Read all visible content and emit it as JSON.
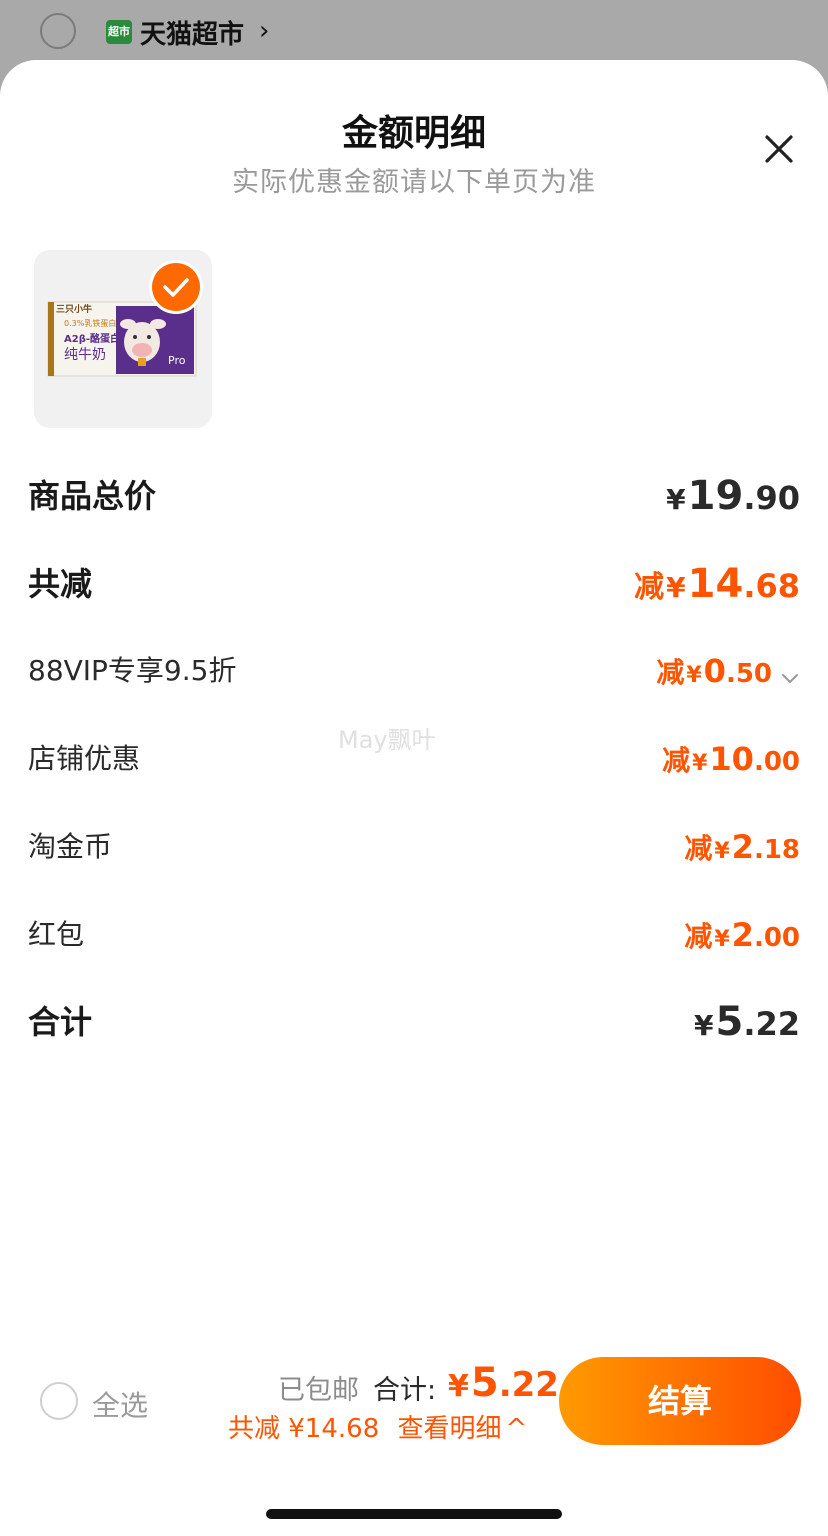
{
  "background_header": {
    "store_logo_text": "超市",
    "store_name": "天猫超市",
    "chevron": "›"
  },
  "sheet": {
    "title": "金额明细",
    "subtitle": "实际优惠金额请以下单页为准",
    "close_icon": "close-icon"
  },
  "product": {
    "thumbnail_icon": "milk-box-image",
    "selected": true,
    "image_texts": {
      "brand": "三只小牛",
      "tag": "0.3%乳铁蛋白",
      "line1": "A2β-酪蛋白",
      "line2": "纯牛奶",
      "pro": "Pro"
    }
  },
  "rows": [
    {
      "label": "商品总价",
      "prefix": "",
      "yen": "¥",
      "int": "19",
      "dec": ".90",
      "style": "major",
      "color": "black"
    },
    {
      "label": "共减",
      "prefix": "减",
      "yen": "¥",
      "int": "14",
      "dec": ".68",
      "style": "major",
      "color": "orange"
    },
    {
      "label": "88VIP专享9.5折",
      "prefix": "减",
      "yen": "¥",
      "int": "0",
      "dec": ".50",
      "style": "minor",
      "color": "orange",
      "expandable": true
    },
    {
      "label": "店铺优惠",
      "prefix": "减",
      "yen": "¥",
      "int": "10",
      "dec": ".00",
      "style": "minor",
      "color": "orange"
    },
    {
      "label": "淘金币",
      "prefix": "减",
      "yen": "¥",
      "int": "2",
      "dec": ".18",
      "style": "minor",
      "color": "orange"
    },
    {
      "label": "红包",
      "prefix": "减",
      "yen": "¥",
      "int": "2",
      "dec": ".00",
      "style": "minor",
      "color": "orange"
    },
    {
      "label": "合计",
      "prefix": "",
      "yen": "¥",
      "int": "5",
      "dec": ".22",
      "style": "major",
      "color": "black"
    }
  ],
  "watermark": "May飘叶",
  "footer": {
    "select_all": "全选",
    "shipping": "已包邮",
    "total_label": "合计:",
    "total_yen": "¥",
    "total_int": "5",
    "total_dec": ".22",
    "discount_text": "共减 ¥14.68",
    "view_detail": "查看明细",
    "view_detail_chevron": "^",
    "checkout": "结算"
  },
  "colors": {
    "accent": "#ff5500",
    "button_gradient_start": "#ff9a00",
    "button_gradient_end": "#ff4d00",
    "overlay": "#a9a9a9"
  }
}
